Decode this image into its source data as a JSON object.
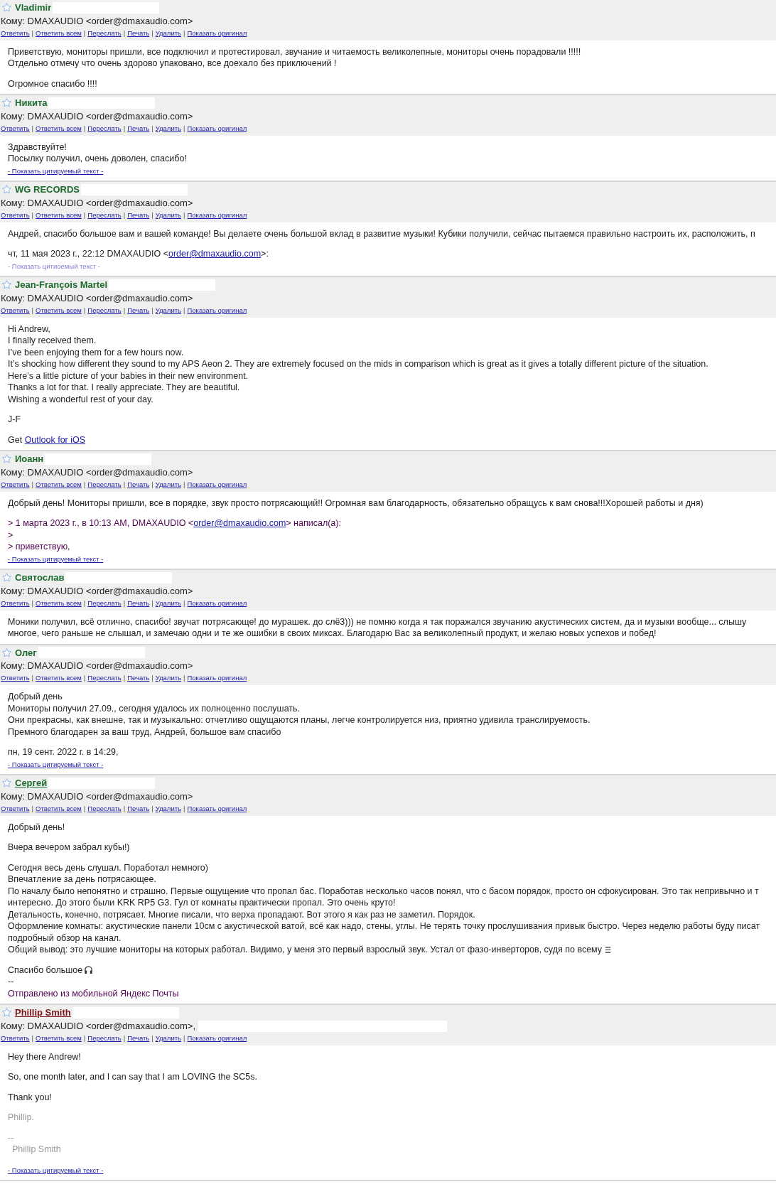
{
  "action_separator": "|",
  "emails": [
    {
      "sender": "Vladimir",
      "sender_underlined": false,
      "sender_visited": false,
      "to": "Кому: DMAXAUDIO <order@dmaxaudio.com>",
      "to_redacted": false,
      "actions": [
        "Ответить",
        "Ответить всем",
        "Переслать",
        "Печать",
        "Удалить",
        "Показать оригинал"
      ],
      "body": [
        {
          "kind": "text",
          "text": "Приветствую, мониторы пришли, все подключил и протестировал, звучание и читаемость великолепные, мониторы очень порадовали !!!!!"
        },
        {
          "kind": "text",
          "text": "Отдельно отмечу что очень здорово упаковано, все доехало без приключений !"
        },
        {
          "kind": "gap"
        },
        {
          "kind": "text",
          "text": "Огромное спасибо !!!!"
        }
      ]
    },
    {
      "sender": "Никита",
      "sender_underlined": false,
      "sender_visited": false,
      "to": "Кому: DMAXAUDIO <order@dmaxaudio.com>",
      "to_redacted": false,
      "actions": [
        "Ответить",
        "Ответить всем",
        "Переслать",
        "Печать",
        "Удалить",
        "Показать оригинал"
      ],
      "body": [
        {
          "kind": "text",
          "text": "Здравствуйте!"
        },
        {
          "kind": "text",
          "text": "Посылку получил, очень доволен, спасибо!"
        }
      ],
      "quote_link": {
        "text": "- Показать цитируемый текст -",
        "underlined": true
      }
    },
    {
      "sender": "WG RECORDS",
      "sender_underlined": false,
      "sender_visited": false,
      "to": "Кому: DMAXAUDIO <order@dmaxaudio.com>",
      "to_redacted": false,
      "actions": [
        "Ответить",
        "Ответить всем",
        "Переслать",
        "Печать",
        "Удалить",
        "Показать оригинал"
      ],
      "body": [
        {
          "kind": "text",
          "text": "Андрей, спасибо большое вам и вашей команде! Вы делаете очень большой вклад в развитие музыки! Кубики получили, сейчас пытаемся правильно настроить их, расположить, п"
        },
        {
          "kind": "gap"
        },
        {
          "kind": "link_line",
          "before": "чт, 11 мая 2023 г., 22:12 DMAXAUDIO <",
          "link": "order@dmaxaudio.com",
          "after": ">:"
        }
      ],
      "quote_link": {
        "text": "- Показать цитиоемый текст -",
        "underlined": false
      }
    },
    {
      "sender": "Jean-François Martel",
      "sender_underlined": false,
      "sender_visited": false,
      "to": "Кому: DMAXAUDIO <order@dmaxaudio.com>",
      "to_redacted": false,
      "actions": [
        "Ответить",
        "Ответить всем",
        "Переслать",
        "Печать",
        "Удалить",
        "Показать оригинал"
      ],
      "body": [
        {
          "kind": "text",
          "text": "Hi Andrew,"
        },
        {
          "kind": "text",
          "text": "I finally received them."
        },
        {
          "kind": "text",
          "text": "I’ve been enjoying them for a few hours now."
        },
        {
          "kind": "text",
          "text": "It’s shocking how different they sound to my APS Aeon 2. They are extremely focused on the mids in comparison which is great as it gives a totally different picture of the situation."
        },
        {
          "kind": "text",
          "text": "Here’s a little picture of your babies in their new environment."
        },
        {
          "kind": "text",
          "text": "Thanks a lot for that. I really appreciate. They are beautiful."
        },
        {
          "kind": "text",
          "text": "Wishing a wonderful rest of your day."
        },
        {
          "kind": "gap"
        },
        {
          "kind": "text",
          "text": "J-F"
        },
        {
          "kind": "gap"
        },
        {
          "kind": "link_line",
          "before": "Get ",
          "link": "Outlook for iOS"
        }
      ]
    },
    {
      "sender": "Иоанн",
      "sender_underlined": false,
      "sender_visited": false,
      "to": "Кому: DMAXAUDIO <order@dmaxaudio.com>",
      "to_redacted": false,
      "actions": [
        "Ответить",
        "Ответить всем",
        "Переслать",
        "Печать",
        "Удалить",
        "Показать оригинал"
      ],
      "body": [
        {
          "kind": "text",
          "text": "Добрый день! Мониторы пришли, все в порядке, звук просто потрясающий!! Огромная вам благодарность, обязательно обращусь к вам снова!!!Хорошей работы и дня)"
        },
        {
          "kind": "gap"
        },
        {
          "kind": "quoted_link_line",
          "before": "> 1 марта 2023 г., в 10:13 AM, DMAXAUDIO <",
          "link": "order@dmaxaudio.com",
          "after": "> написал(а):"
        },
        {
          "kind": "quoted",
          "text": ">"
        },
        {
          "kind": "quoted",
          "text": "> приветствую,"
        }
      ],
      "quote_link": {
        "text": "- Показать цитируемый текст -",
        "underlined": true
      }
    },
    {
      "sender": "Святослав",
      "sender_underlined": false,
      "sender_visited": false,
      "to": "Кому: DMAXAUDIO <order@dmaxaudio.com>",
      "to_redacted": false,
      "actions": [
        "Ответить",
        "Ответить всем",
        "Переслать",
        "Печать",
        "Удалить",
        "Показать оригинал"
      ],
      "body": [
        {
          "kind": "text",
          "text": "Моники получил, всё отлично, спасибо! звучат потрясающе! до мурашек. до слё3))) не помню когда я так поражался звучанию акустических систем, да и музыки вообще... слышу многое, чего раньше не слышал, и замечаю одни и те же ошибки в своих миксах. Благодарю Вас за великолепный продукт, и желаю новых успехов и побед!"
        }
      ]
    },
    {
      "sender": "Олег",
      "sender_underlined": false,
      "sender_visited": false,
      "to": "Кому: DMAXAUDIO <order@dmaxaudio.com>",
      "to_redacted": false,
      "actions": [
        "Ответить",
        "Ответить всем",
        "Переслать",
        "Печать",
        "Удалить",
        "Показать оригинал"
      ],
      "body": [
        {
          "kind": "text",
          "text": "Добрый день"
        },
        {
          "kind": "text",
          "text": "Мониторы получил 27.09., сегодня удалось их полноценно послушать."
        },
        {
          "kind": "text",
          "text": "Они прекрасны, как внешне, так и музыкально: отчетливо ощущаются планы, легче контролируется низ, приятно удивила транслируемость."
        },
        {
          "kind": "text",
          "text": "Премного благодарен за ваш труд, Андрей, большое вам спасибо"
        },
        {
          "kind": "gap"
        },
        {
          "kind": "text",
          "text": "пн, 19 сент. 2022 г. в 14:29,"
        }
      ],
      "quote_link": {
        "text": "- Показать цитируемый текст -",
        "underlined": true
      }
    },
    {
      "sender": "Сергей",
      "sender_underlined": true,
      "sender_visited": false,
      "to": "Кому: DMAXAUDIO <order@dmaxaudio.com>",
      "to_redacted": false,
      "actions": [
        "Ответить",
        "Ответить всем",
        "Переслать",
        "Печать",
        "Удалить",
        "Показать оригинал"
      ],
      "body": [
        {
          "kind": "text",
          "text": "Добрый день!"
        },
        {
          "kind": "gap"
        },
        {
          "kind": "text",
          "text": "Вчера вечером забрал кубы!)"
        },
        {
          "kind": "gap"
        },
        {
          "kind": "text",
          "text": "Сегодня весь день слушал. Поработал немного)"
        },
        {
          "kind": "text",
          "text": "Впечатление за день потрясающее."
        },
        {
          "kind": "text",
          "text": "По началу было непонятно и страшно. Первые ощущение что пропал бас. Поработав несколько часов понял, что с басом порядок, просто он сфокусирован. Это так непривычно и т"
        },
        {
          "kind": "text",
          "text": "интересно. До этого были KRK RP5 G3. Гул от комнаты практически пропал. Это очень круто!"
        },
        {
          "kind": "text",
          "text": "Детальность, конечно, потрясает. Многие писали, что верха пропадают. Вот этого я как раз не заметил. Порядок."
        },
        {
          "kind": "text",
          "text": "Оформление комнаты: акустические панели 10см с акустической ватой, всё как надо, стены, углы. Не терять точку прослушивания привык быстро. Через неделю работы буду писат"
        },
        {
          "kind": "text",
          "text": "подробный обзор на канал."
        },
        {
          "kind": "text_glyph",
          "text": "Общий вывод: это лучшие мониторы на которых работал. Видимо, у меня это первый взрослый звук. Устал от фазо-инверторов, судя по всему"
        },
        {
          "kind": "gap"
        },
        {
          "kind": "text_emoji",
          "text": "Спасибо большое"
        },
        {
          "kind": "quoted",
          "text": "--"
        },
        {
          "kind": "quoted",
          "text": "Отправлено из мобильной Яндекс Почты"
        }
      ]
    },
    {
      "sender": "Phillip Smith",
      "sender_underlined": true,
      "sender_visited": true,
      "to": "Кому: DMAXAUDIO <order@dmaxaudio.com>,",
      "to_redacted": true,
      "actions": [
        "Ответить",
        "Ответить всем",
        "Переслать",
        "Печать",
        "Удалить",
        "Показать оригинал"
      ],
      "body": [
        {
          "kind": "text",
          "text": "Hey there Andrew!"
        },
        {
          "kind": "gap"
        },
        {
          "kind": "text",
          "text": "So, one month later, and I can say that I am LOVING the SC5s."
        },
        {
          "kind": "gap"
        },
        {
          "kind": "text",
          "text": "Thank you!"
        },
        {
          "kind": "gap"
        },
        {
          "kind": "muted",
          "text": "Phillip."
        },
        {
          "kind": "gap"
        },
        {
          "kind": "muted",
          "text": "--"
        },
        {
          "kind": "muted_indent",
          "text": "Phillip Smith"
        },
        {
          "kind": "gap"
        }
      ],
      "quote_link": {
        "text": "- Показать цитируемый текст -",
        "underlined": true
      }
    }
  ]
}
